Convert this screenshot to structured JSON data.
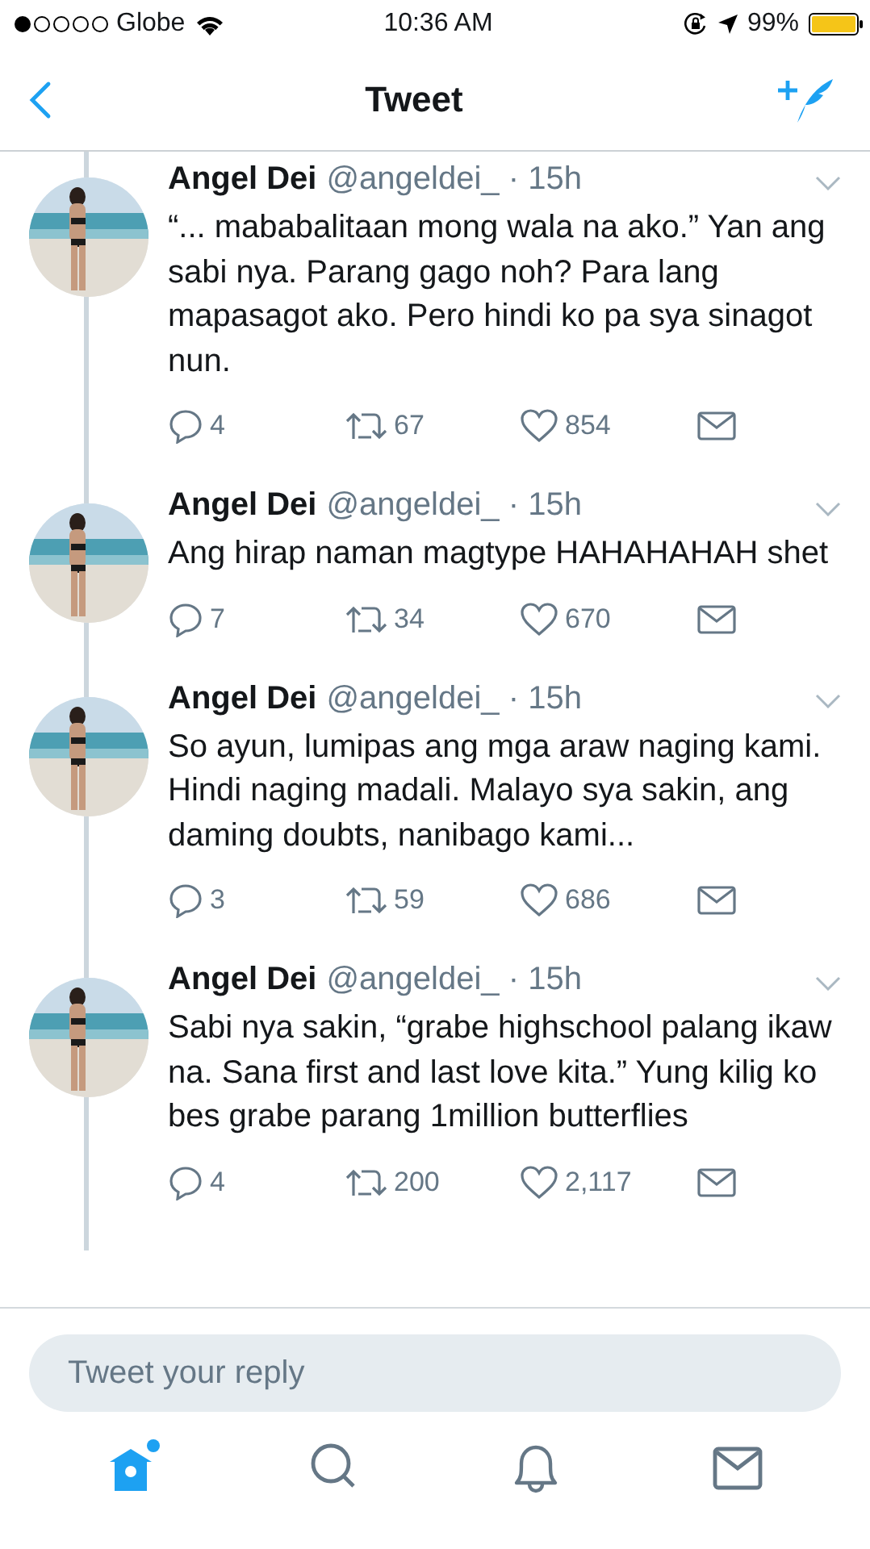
{
  "status_bar": {
    "carrier": "Globe",
    "time": "10:36 AM",
    "battery": "99%"
  },
  "nav": {
    "title": "Tweet"
  },
  "tweets": [
    {
      "name": "Angel Dei",
      "meta": "@angeldei_ · 15h",
      "text": "“... mababalitaan mong wala na ako.” Yan ang sabi nya. Parang gago noh? Para lang mapasagot ako. Pero hindi ko pa sya sinagot nun.",
      "replies": "4",
      "retweets": "67",
      "likes": "854"
    },
    {
      "name": "Angel Dei",
      "meta": "@angeldei_ · 15h",
      "text": "Ang hirap naman magtype HAHAHAHAH shet",
      "replies": "7",
      "retweets": "34",
      "likes": "670"
    },
    {
      "name": "Angel Dei",
      "meta": "@angeldei_ · 15h",
      "text": "So ayun, lumipas ang mga araw naging kami. Hindi naging madali. Malayo sya sakin, ang daming doubts, nanibago kami...",
      "replies": "3",
      "retweets": "59",
      "likes": "686"
    },
    {
      "name": "Angel Dei",
      "meta": "@angeldei_ · 15h",
      "text": "Sabi nya sakin, “grabe highschool palang ikaw na. Sana first and last love kita.” Yung kilig ko bes grabe parang 1million butterflies",
      "replies": "4",
      "retweets": "200",
      "likes": "2,117"
    }
  ],
  "reply": {
    "placeholder": "Tweet your reply"
  },
  "tabs": [
    {
      "kind": "home",
      "selected": true,
      "badge": true
    },
    {
      "kind": "search",
      "selected": false,
      "badge": false
    },
    {
      "kind": "notifications",
      "selected": false,
      "badge": false
    },
    {
      "kind": "messages",
      "selected": false,
      "badge": false
    }
  ]
}
